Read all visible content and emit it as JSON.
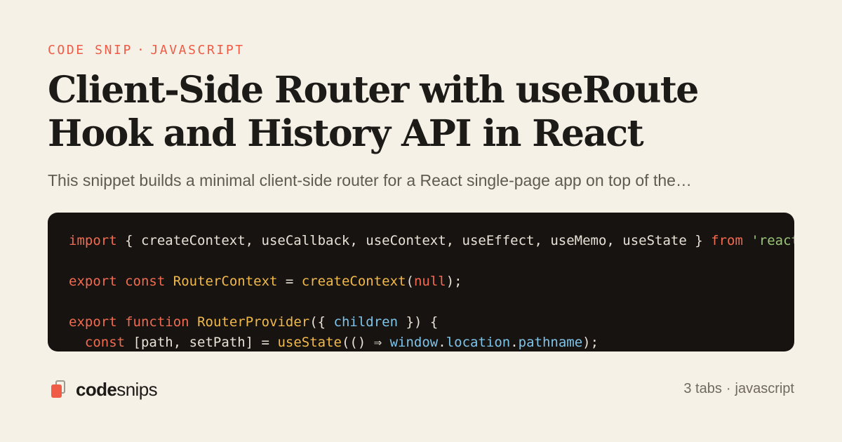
{
  "eyebrow": {
    "category": "CODE SNIP",
    "separator": "·",
    "language": "JAVASCRIPT"
  },
  "title": "Client-Side Router with useRoute Hook and History API in React",
  "subtitle": "This snippet builds a minimal client-side router for a React single-page app on top of the…",
  "code": {
    "lines": [
      [
        {
          "t": "import",
          "c": "kw"
        },
        {
          "t": " { createContext, useCallback, useContext, useEffect, useMemo, useState } ",
          "c": "op"
        },
        {
          "t": "from",
          "c": "kw"
        },
        {
          "t": " ",
          "c": "op"
        },
        {
          "t": "'react'",
          "c": "str"
        }
      ],
      [],
      [
        {
          "t": "export",
          "c": "kw"
        },
        {
          "t": " ",
          "c": "op"
        },
        {
          "t": "const",
          "c": "kw"
        },
        {
          "t": " ",
          "c": "op"
        },
        {
          "t": "RouterContext",
          "c": "fn"
        },
        {
          "t": " = ",
          "c": "op"
        },
        {
          "t": "createContext",
          "c": "fn"
        },
        {
          "t": "(",
          "c": "op"
        },
        {
          "t": "null",
          "c": "kw"
        },
        {
          "t": ");",
          "c": "op"
        }
      ],
      [],
      [
        {
          "t": "export",
          "c": "kw"
        },
        {
          "t": " ",
          "c": "op"
        },
        {
          "t": "function",
          "c": "kw"
        },
        {
          "t": " ",
          "c": "op"
        },
        {
          "t": "RouterProvider",
          "c": "fn"
        },
        {
          "t": "({ ",
          "c": "op"
        },
        {
          "t": "children",
          "c": "var"
        },
        {
          "t": " }) {",
          "c": "op"
        }
      ],
      [
        {
          "t": "  ",
          "c": "op"
        },
        {
          "t": "const",
          "c": "kw"
        },
        {
          "t": " [path, setPath] = ",
          "c": "op"
        },
        {
          "t": "useState",
          "c": "fn"
        },
        {
          "t": "(() ⇒ ",
          "c": "op"
        },
        {
          "t": "window",
          "c": "var"
        },
        {
          "t": ".",
          "c": "op"
        },
        {
          "t": "location",
          "c": "var"
        },
        {
          "t": ".",
          "c": "op"
        },
        {
          "t": "pathname",
          "c": "var"
        },
        {
          "t": ");",
          "c": "op"
        }
      ]
    ]
  },
  "brand": {
    "icon": "snippet-pages-icon",
    "name_bold": "code",
    "name_light": "snips"
  },
  "meta": {
    "tabs": "3 tabs",
    "separator": "·",
    "language": "javascript"
  },
  "colors": {
    "accent": "#ef5b45",
    "background": "#f6f1e7",
    "code_background": "#161311",
    "keyword": "#f26b50",
    "function": "#f2b94b",
    "variable": "#7fc3e8",
    "string": "#9bc678"
  }
}
